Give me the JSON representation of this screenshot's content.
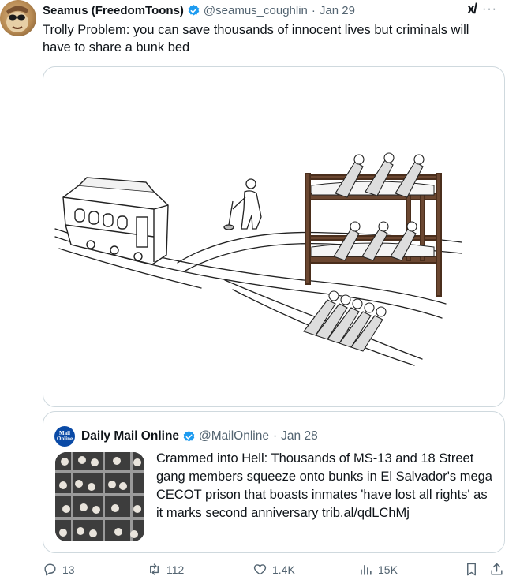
{
  "tweet": {
    "author_name": "Seamus (FreedomToons)",
    "handle": "@seamus_coughlin",
    "separator": "·",
    "date": "Jan 29",
    "grok_label": "x/",
    "more_label": "···",
    "text": "Trolly Problem: you can save thousands of innocent lives but criminals will have to share a bunk bed"
  },
  "quote": {
    "logo_line1": "Mail",
    "logo_line2": "Online",
    "author_name": "Daily Mail Online",
    "handle": "@MailOnline",
    "separator": "·",
    "date": "Jan 28",
    "text": "Crammed into Hell: Thousands of MS-13 and 18 Street gang members squeeze onto bunks in El Salvador's mega CECOT prison that boasts inmates 'have lost all rights' as it marks second anniversary trib.al/qdLChMj"
  },
  "actions": {
    "replies": "13",
    "reposts": "112",
    "likes": "1.4K",
    "views": "15K"
  },
  "colors": {
    "verified": "#1d9bf0",
    "muted": "#536471",
    "border": "#cfd9de",
    "mail_blue": "#0a4aa6"
  }
}
